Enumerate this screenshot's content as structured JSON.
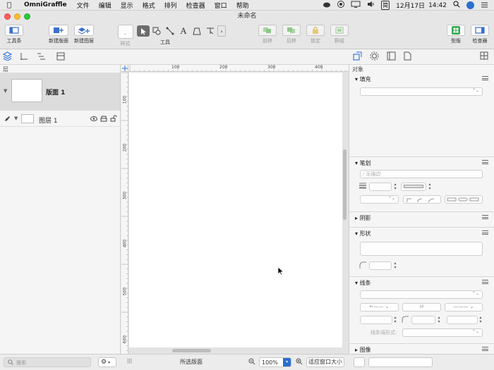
{
  "menubar": {
    "app": "OmniGraffle",
    "items": [
      "文件",
      "编辑",
      "显示",
      "格式",
      "排列",
      "检查器",
      "窗口",
      "帮助"
    ],
    "ime": "简",
    "date": "12月17日",
    "time": "14:42"
  },
  "window": {
    "title": "未命名"
  },
  "toolbar": {
    "toolbar_label": "工具条",
    "new_canvas": "新建版面",
    "new_layer": "新建图层",
    "style_label": "样式",
    "tools_label": "工具",
    "forward": "前移",
    "backward": "后移",
    "lock": "锁定",
    "group": "群组",
    "template": "型版",
    "inspector": "检查器"
  },
  "left": {
    "header": "层",
    "canvas_name": "版面 1",
    "layer_name": "图层 1"
  },
  "ruler": {
    "h_ticks": [
      "100",
      "200",
      "300",
      "400"
    ],
    "v_ticks": [
      "100",
      "200",
      "300",
      "400",
      "500",
      "600"
    ]
  },
  "inspector": {
    "header": "对象",
    "fill": "填充",
    "stroke": "笔划",
    "stroke_value": "无描边",
    "shadow": "阴影",
    "shape": "形状",
    "line": "线条",
    "line_type_placeholder": "线条端形式:",
    "image": "图像"
  },
  "bottom": {
    "search_placeholder": "搜索",
    "selection": "所选版面",
    "zoom": "100%",
    "fit": "适应窗口大小"
  },
  "colors": {
    "accent": "#1a73e8",
    "green": "#34a853"
  }
}
